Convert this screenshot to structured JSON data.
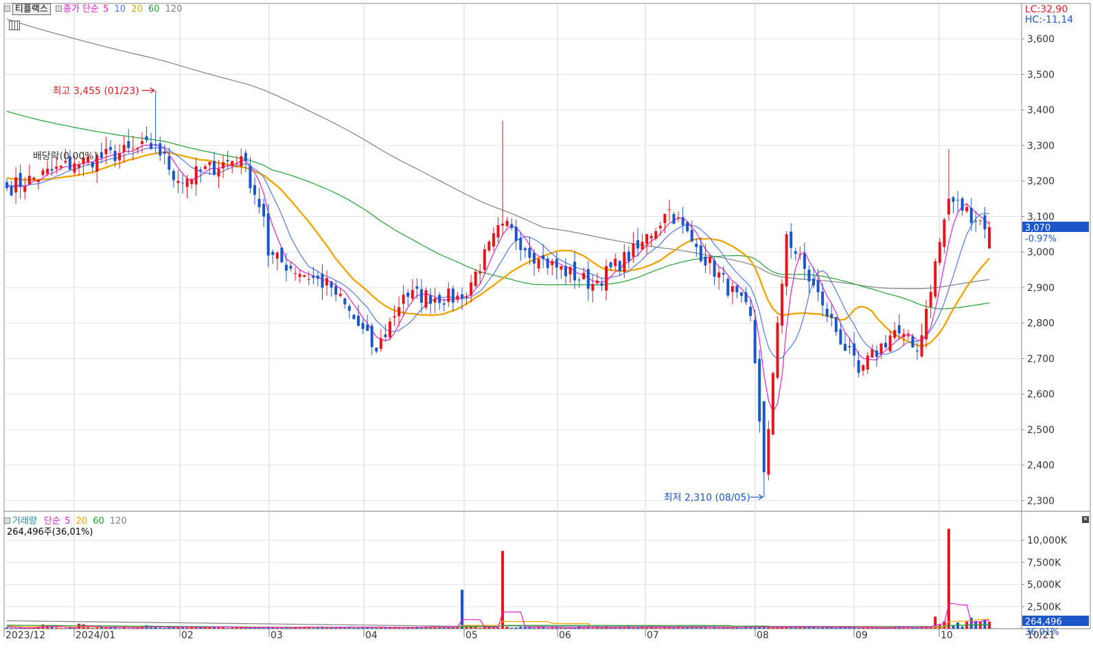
{
  "header": {
    "stock_name": "티플랙스",
    "price_label": "종가 단순",
    "ma_periods": [
      "5",
      "10",
      "20",
      "60",
      "120"
    ],
    "lc": "LC:32,90",
    "hc": "HC:-11,14"
  },
  "volume_header": {
    "label": "거래량",
    "ma_label": "단순",
    "ma_periods": [
      "5",
      "20",
      "60",
      "120"
    ],
    "current": "264,496주(36,01%)"
  },
  "colors": {
    "up": "#e8141c",
    "down": "#1a56c8",
    "ma5": "#e020d0",
    "ma10": "#4f7ae8",
    "ma20": "#f0a500",
    "ma60": "#20a030",
    "ma120": "#808080",
    "current_price_tag": "#1a56c8"
  },
  "chart_data": [
    {
      "type": "candlestick",
      "x_ticks": [
        "2023/12",
        "2024/01",
        "02",
        "03",
        "04",
        "05",
        "06",
        "07",
        "08",
        "09",
        "10"
      ],
      "y_ticks": [
        "3,600",
        "3,500",
        "3,400",
        "3,300",
        "3,200",
        "3,100",
        "3,000",
        "2,900",
        "2,800",
        "2,700",
        "2,600",
        "2,500",
        "2,400",
        "2,300"
      ],
      "ylim": [
        2270,
        3700
      ],
      "last_price": 3070,
      "last_price_label": "3,070",
      "last_change_label": "-0.97%",
      "annotations": {
        "high": "최고 3,455 (01/23)",
        "low": "최저 2,310 (08/05)",
        "dividend": "배당락(0.00%)"
      },
      "anchor_points": [
        {
          "date": "2023/12",
          "close": 3180
        },
        {
          "date": "2024/01",
          "close": 3250
        },
        {
          "date": "01/23",
          "close": 3300,
          "high": 3455
        },
        {
          "date": "02",
          "close": 3200
        },
        {
          "date": "02 mid",
          "close": 3270
        },
        {
          "date": "03",
          "close": 3100
        },
        {
          "date": "03 mid",
          "close": 2990
        },
        {
          "date": "04",
          "close": 2900
        },
        {
          "date": "04 mid",
          "close": 2720
        },
        {
          "date": "04 late",
          "close": 2880
        },
        {
          "date": "05",
          "close": 2870
        },
        {
          "date": "05 mid",
          "close": 3080,
          "high": 3370
        },
        {
          "date": "06",
          "close": 2980
        },
        {
          "date": "06 mid",
          "close": 2910
        },
        {
          "date": "07",
          "close": 3010
        },
        {
          "date": "07 mid",
          "close": 3120
        },
        {
          "date": "07 late",
          "close": 3030
        },
        {
          "date": "08",
          "close": 2820
        },
        {
          "date": "08/05",
          "close": 2380,
          "low": 2310
        },
        {
          "date": "08 mid",
          "close": 3050
        },
        {
          "date": "09",
          "close": 2850
        },
        {
          "date": "09 mid",
          "close": 2660
        },
        {
          "date": "09 late",
          "close": 2780
        },
        {
          "date": "10",
          "close": 2720
        },
        {
          "date": "10 mid",
          "close": 3150,
          "high": 3290
        },
        {
          "date": "10/21",
          "close": 3070
        }
      ],
      "ma_series": [
        {
          "name": "5",
          "last": 3040
        },
        {
          "name": "10",
          "last": 2980
        },
        {
          "name": "20",
          "last": 2880
        },
        {
          "name": "60",
          "last": 2850
        },
        {
          "name": "120",
          "last": 2910
        }
      ]
    },
    {
      "type": "bar",
      "y_ticks": [
        "10,000K",
        "7,500K",
        "5,000K",
        "2,500K"
      ],
      "ylim": [
        0,
        11300
      ],
      "last_volume_label": "264,496",
      "last_ratio_label": "36,01%",
      "spikes": [
        {
          "date": "04 late",
          "value": 4400
        },
        {
          "date": "05 mid",
          "value": 8800
        },
        {
          "date": "10 mid",
          "value": 11300
        }
      ]
    }
  ],
  "bottom_axis": {
    "right_label": "10/21"
  }
}
